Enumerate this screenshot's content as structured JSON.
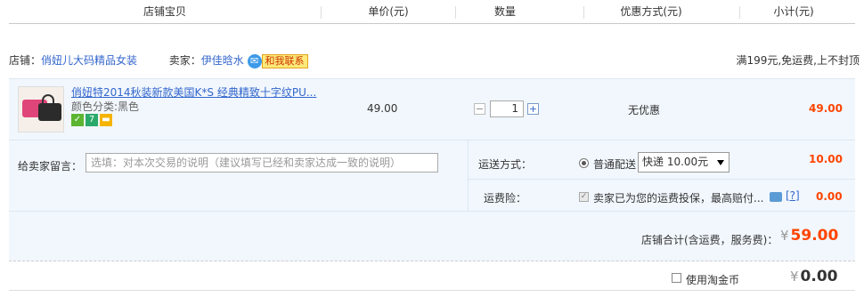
{
  "header": {
    "col_item": "店铺宝贝",
    "col_price": "单价(元)",
    "col_qty": "数量",
    "col_discount": "优惠方式(元)",
    "col_subtotal": "小计(元)"
  },
  "shop": {
    "shop_label": "店铺：",
    "shop_name": "俏妞儿大码精品女装",
    "seller_label": "卖家：",
    "seller_name": "伊佳晗水",
    "contact_label": "和我联系",
    "promo": "满199元,免运费,上不封顶"
  },
  "item": {
    "title": "俏妞特2014秋装新款美国K*S 经典精致十字纹PU...",
    "sku": "颜色分类:黑色",
    "price": "49.00",
    "quantity": "1",
    "discount": "无优惠",
    "subtotal": "49.00",
    "service_icons": [
      "guarantee-icon",
      "seven-day-return-icon",
      "credit-card-icon"
    ]
  },
  "message": {
    "label": "给卖家留言：",
    "placeholder": "选填：对本次交易的说明（建议填写已经和卖家达成一致的说明）"
  },
  "shipping": {
    "label": "运送方式：",
    "option": "普通配送",
    "selected": "快递 10.00元",
    "fee": "10.00"
  },
  "insurance": {
    "label": "运费险：",
    "text": "卖家已为您的运费投保，最高赔付...",
    "help": "[?]",
    "fee": "0.00"
  },
  "total": {
    "label": "店铺合计(含运费，服务费)：",
    "currency": "¥",
    "value": "59.00"
  },
  "coin": {
    "label": "使用淘金币",
    "currency": "¥",
    "value": "0.00"
  },
  "colors": {
    "accent_price": "#ff4400",
    "link": "#3366cc",
    "row_bg": "#f1f7fd"
  }
}
